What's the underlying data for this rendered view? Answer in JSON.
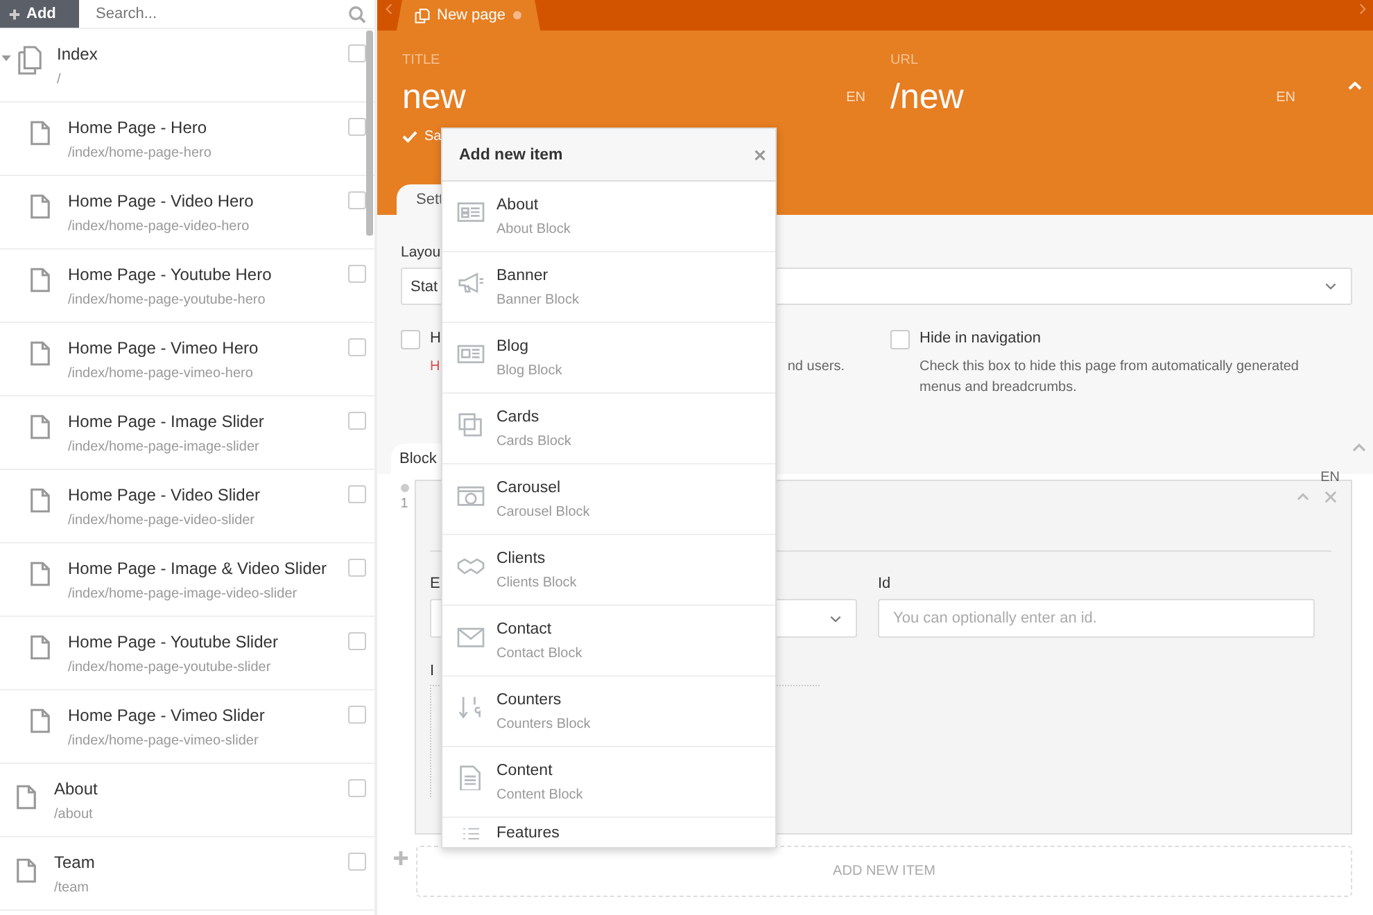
{
  "sidebar": {
    "add_button": "Add",
    "search": {
      "placeholder": "Search..."
    },
    "tree": [
      {
        "title": "Index",
        "path": "/",
        "expanded": true,
        "checked": false,
        "children": [
          {
            "title": "Home Page - Hero",
            "path": "/index/home-page-hero",
            "checked": false
          },
          {
            "title": "Home Page - Video Hero",
            "path": "/index/home-page-video-hero",
            "checked": false
          },
          {
            "title": "Home Page - Youtube Hero",
            "path": "/index/home-page-youtube-hero",
            "checked": false
          },
          {
            "title": "Home Page - Vimeo Hero",
            "path": "/index/home-page-vimeo-hero",
            "checked": false
          },
          {
            "title": "Home Page - Image Slider",
            "path": "/index/home-page-image-slider",
            "checked": false
          },
          {
            "title": "Home Page - Video Slider",
            "path": "/index/home-page-video-slider",
            "checked": false
          },
          {
            "title": "Home Page - Image & Video Slider",
            "path": "/index/home-page-image-video-slider",
            "checked": false
          },
          {
            "title": "Home Page - Youtube Slider",
            "path": "/index/home-page-youtube-slider",
            "checked": false
          },
          {
            "title": "Home Page - Vimeo Slider",
            "path": "/index/home-page-vimeo-slider",
            "checked": false
          }
        ]
      },
      {
        "title": "About",
        "path": "/about",
        "checked": false
      },
      {
        "title": "Team",
        "path": "/team",
        "checked": false
      }
    ]
  },
  "editor": {
    "tabs": [
      {
        "label": "New page",
        "selected": true,
        "unsaved": true
      }
    ],
    "title_field": {
      "label": "TITLE",
      "value": "new",
      "lang": "EN"
    },
    "url_field": {
      "label": "URL",
      "value": "/new",
      "lang": "EN"
    },
    "saved_note": "Sa",
    "section_tabs": [
      {
        "label": "Sett",
        "selected": true
      }
    ],
    "layout": {
      "label": "Layou",
      "value": "Stat"
    },
    "options": [
      {
        "label": "H",
        "warning": "H",
        "description": "nd users.",
        "checked": false
      },
      {
        "label": "Hide in navigation",
        "description": "Check this box to hide this page from automatically generated menus and breadcrumbs.",
        "checked": false
      }
    ],
    "blocks": {
      "tab": "Block",
      "lang": "EN",
      "items": [
        {
          "number": "1",
          "field_1_label": "E",
          "id_label": "Id",
          "id_placeholder": "You can optionally enter an id.",
          "field_3_label": "I"
        }
      ],
      "add_button": "ADD NEW ITEM"
    }
  },
  "popup": {
    "title": "Add new item",
    "items": [
      {
        "label": "About",
        "description": "About Block"
      },
      {
        "label": "Banner",
        "description": "Banner Block"
      },
      {
        "label": "Blog",
        "description": "Blog Block"
      },
      {
        "label": "Cards",
        "description": "Cards Block"
      },
      {
        "label": "Carousel",
        "description": "Carousel Block"
      },
      {
        "label": "Clients",
        "description": "Clients Block"
      },
      {
        "label": "Contact",
        "description": "Contact Block"
      },
      {
        "label": "Counters",
        "description": "Counters Block"
      },
      {
        "label": "Content",
        "description": "Content Block"
      },
      {
        "label": "Features"
      }
    ]
  }
}
